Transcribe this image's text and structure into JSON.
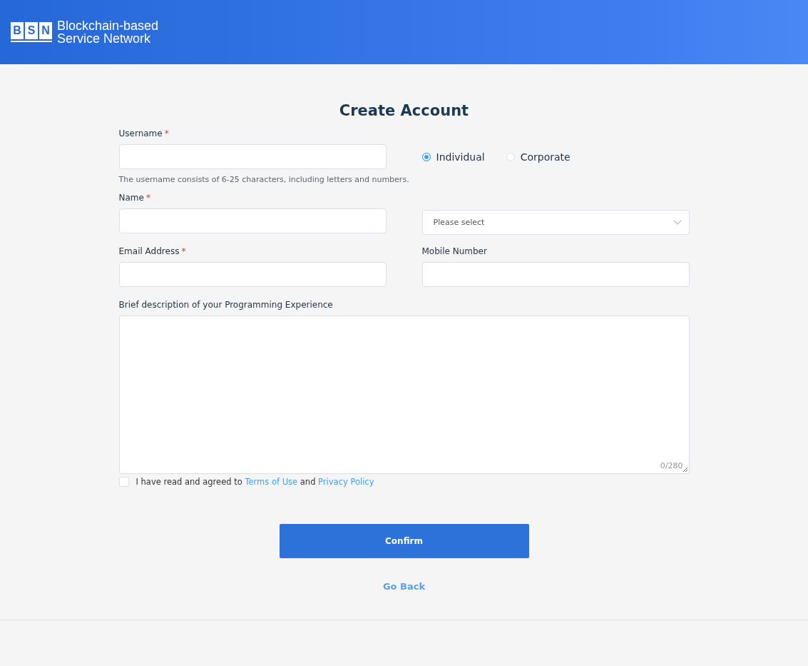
{
  "header": {
    "logo_letters": [
      "B",
      "S",
      "N"
    ],
    "brand_lines": [
      "Blockchain-based",
      "Service Network"
    ]
  },
  "title": "Create Account",
  "username": {
    "label": "Username",
    "required_mark": "*",
    "hint": "The username consists of 6-25 characters, including letters and numbers."
  },
  "account_type": [
    {
      "label": "Individual",
      "selected": true
    },
    {
      "label": "Corporate",
      "selected": false
    }
  ],
  "name": {
    "label": "Name",
    "required_mark": "*"
  },
  "select": {
    "placeholder": "Please select"
  },
  "email": {
    "label": "Email Address",
    "required_mark": "*"
  },
  "mobile": {
    "label": "Mobile Number"
  },
  "description": {
    "label": "Brief description of your Programming Experience",
    "counter": "0/280"
  },
  "agreement": {
    "checked": false,
    "text": "I have read and agreed to",
    "terms_link": "Terms of Use",
    "joiner": "and",
    "privacy_link": "Privacy Policy"
  },
  "confirm_button": "Confirm",
  "back_link": "Go Back"
}
